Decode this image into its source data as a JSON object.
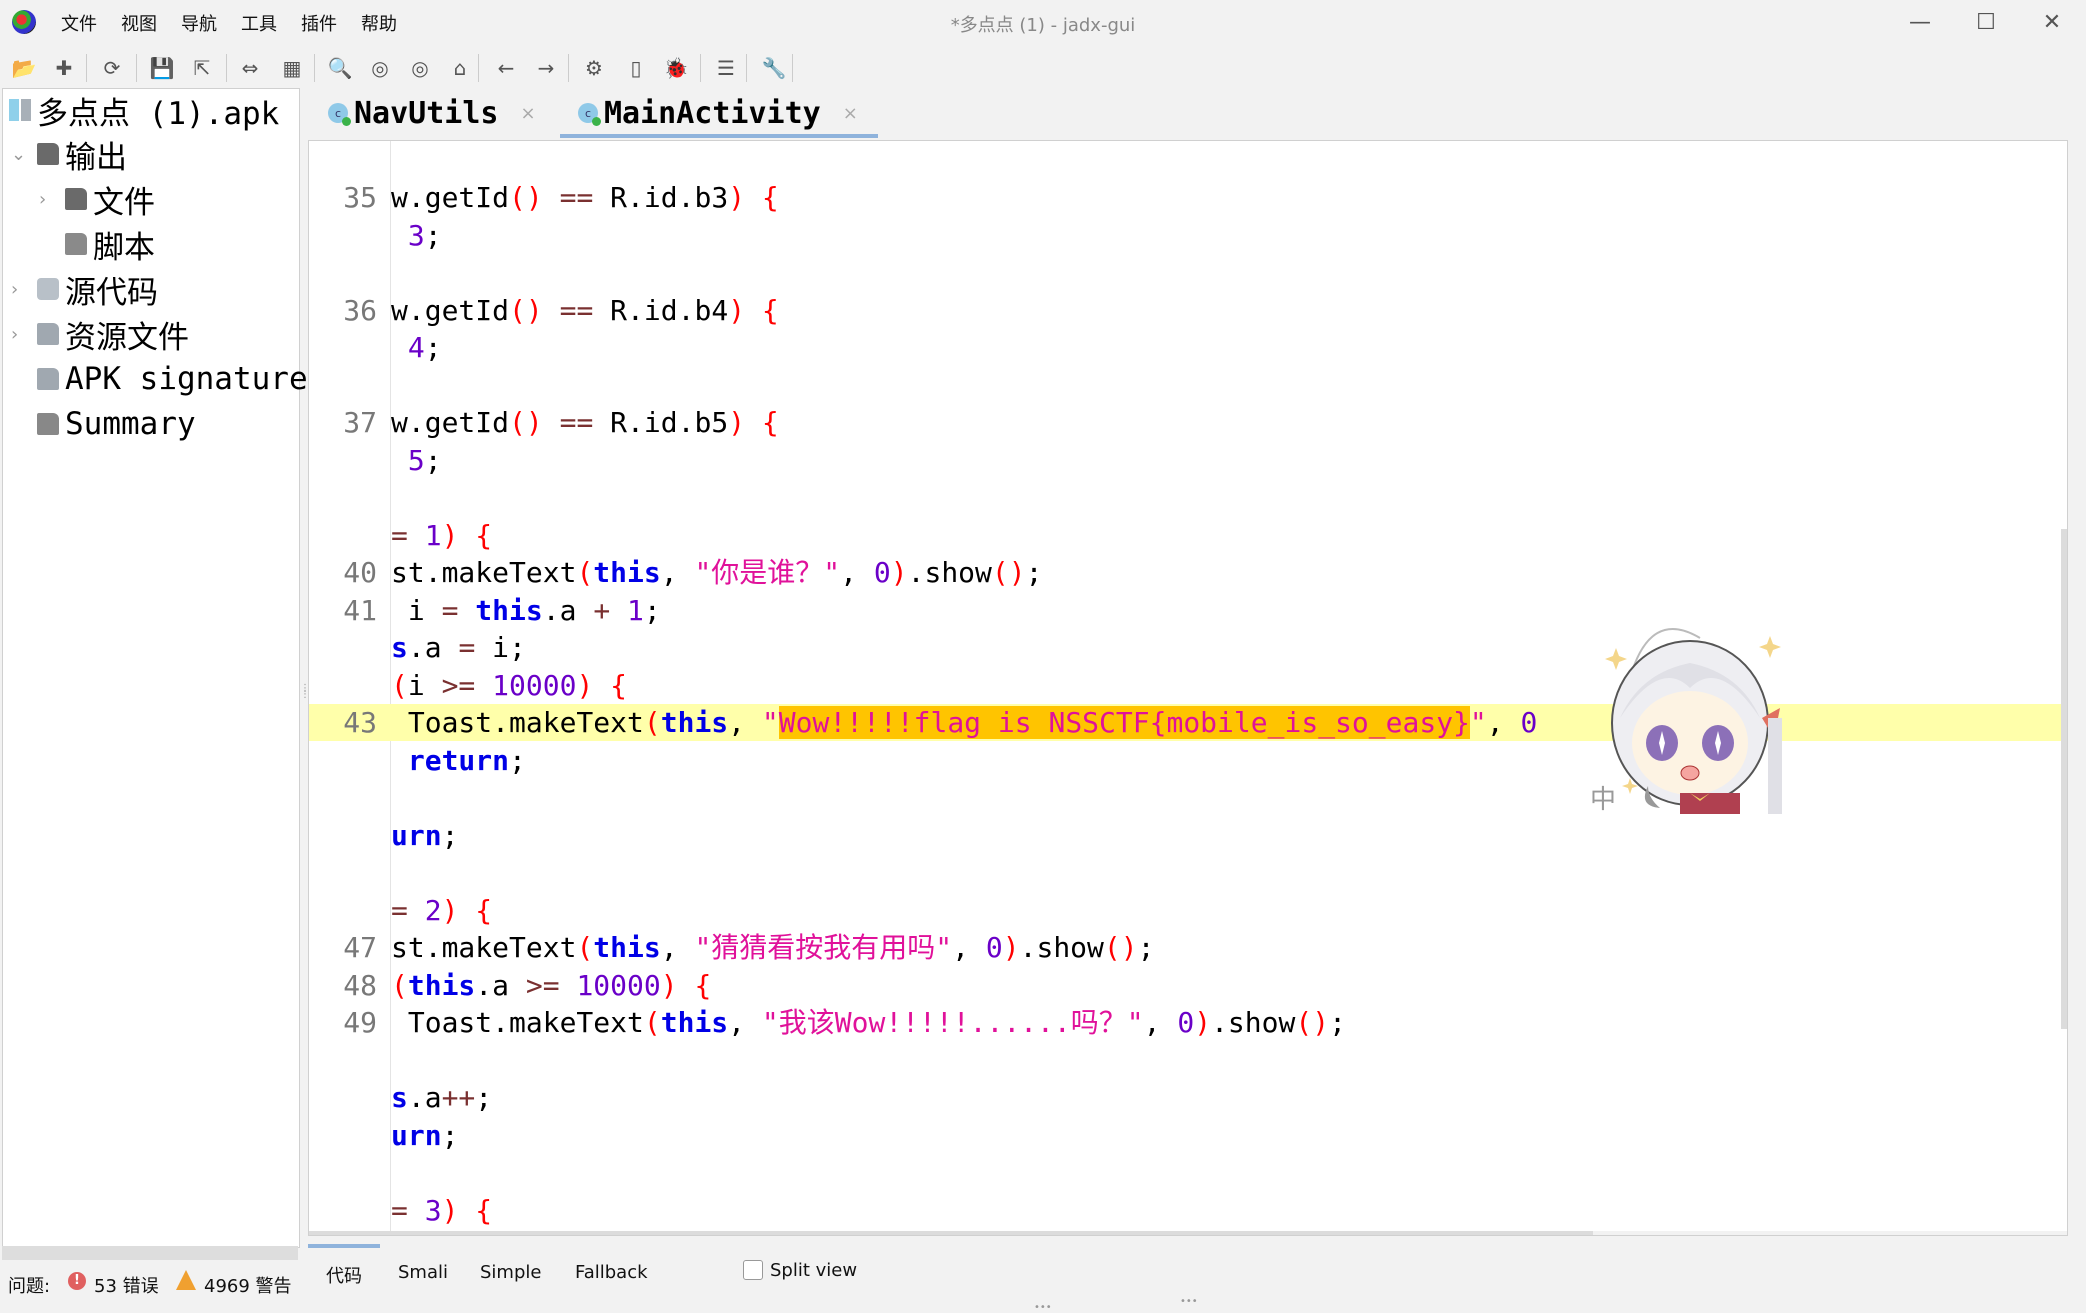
{
  "window": {
    "title": "*多点点 (1) - jadx-gui",
    "controls": {
      "minimize": "—",
      "maximize": "☐",
      "close": "✕"
    }
  },
  "menu": [
    "文件",
    "视图",
    "导航",
    "工具",
    "插件",
    "帮助"
  ],
  "toolbar": [
    {
      "icon": "open-folder-icon",
      "glyph": "📂"
    },
    {
      "icon": "add-file-icon",
      "glyph": "✚"
    },
    {
      "icon": "reload-icon",
      "glyph": "⟳"
    },
    {
      "icon": "save-icon",
      "glyph": "💾"
    },
    {
      "icon": "export-icon",
      "glyph": "⇱"
    },
    {
      "icon": "sync-tree-icon",
      "glyph": "⇔"
    },
    {
      "icon": "flatten-packages-icon",
      "glyph": "▦"
    },
    {
      "icon": "search-icon",
      "glyph": "🔍"
    },
    {
      "icon": "find-class-icon",
      "glyph": "◎"
    },
    {
      "icon": "find-usage-icon",
      "glyph": "◎"
    },
    {
      "icon": "home-icon",
      "glyph": "⌂"
    },
    {
      "icon": "back-icon",
      "glyph": "←"
    },
    {
      "icon": "forward-icon",
      "glyph": "→"
    },
    {
      "icon": "deobfuscation-icon",
      "glyph": "⚙"
    },
    {
      "icon": "device-icon",
      "glyph": "▯"
    },
    {
      "icon": "debugger-icon",
      "glyph": "🐞"
    },
    {
      "icon": "log-viewer-icon",
      "glyph": "☰"
    },
    {
      "icon": "preferences-icon",
      "glyph": "🔧"
    }
  ],
  "tree": {
    "root": "多点点 (1).apk",
    "items": [
      {
        "label": "输出",
        "icon": "output-folder-icon",
        "expanded": true,
        "chevron": "⌄"
      },
      {
        "label": "文件",
        "icon": "files-folder-icon",
        "chevron": "›"
      },
      {
        "label": "脚本",
        "icon": "scripts-folder-icon",
        "chevron": ""
      },
      {
        "label": "源代码",
        "icon": "source-code-icon",
        "chevron": "›"
      },
      {
        "label": "资源文件",
        "icon": "resources-folder-icon",
        "chevron": "›"
      },
      {
        "label": "APK signature",
        "icon": "apk-signature-icon",
        "chevron": ""
      },
      {
        "label": "Summary",
        "icon": "summary-icon",
        "chevron": ""
      }
    ]
  },
  "tabs": [
    {
      "label": "NavUtils",
      "active": false,
      "close": "×",
      "class_glyph": "c"
    },
    {
      "label": "MainActivity",
      "active": true,
      "close": "×",
      "class_glyph": "c"
    }
  ],
  "code": {
    "lines": [
      {
        "ln": "35",
        "segs": [
          [
            "",
            "w.getId"
          ],
          [
            "br",
            "()"
          ],
          [
            "op",
            " == "
          ],
          [
            "",
            "R.id.b3"
          ],
          [
            "br",
            ")"
          ],
          [
            "",
            " "
          ],
          [
            "br",
            "{"
          ]
        ]
      },
      {
        "ln": "",
        "segs": [
          [
            "",
            " "
          ],
          [
            "num",
            "3"
          ],
          [
            "",
            ";"
          ]
        ]
      },
      {
        "ln": "",
        "segs": []
      },
      {
        "ln": "36",
        "segs": [
          [
            "",
            "w.getId"
          ],
          [
            "br",
            "()"
          ],
          [
            "op",
            " == "
          ],
          [
            "",
            "R.id.b4"
          ],
          [
            "br",
            ")"
          ],
          [
            "",
            " "
          ],
          [
            "br",
            "{"
          ]
        ]
      },
      {
        "ln": "",
        "segs": [
          [
            "",
            " "
          ],
          [
            "num",
            "4"
          ],
          [
            "",
            ";"
          ]
        ]
      },
      {
        "ln": "",
        "segs": []
      },
      {
        "ln": "37",
        "segs": [
          [
            "",
            "w.getId"
          ],
          [
            "br",
            "()"
          ],
          [
            "op",
            " == "
          ],
          [
            "",
            "R.id.b5"
          ],
          [
            "br",
            ")"
          ],
          [
            "",
            " "
          ],
          [
            "br",
            "{"
          ]
        ]
      },
      {
        "ln": "",
        "segs": [
          [
            "",
            " "
          ],
          [
            "num",
            "5"
          ],
          [
            "",
            ";"
          ]
        ]
      },
      {
        "ln": "",
        "segs": []
      },
      {
        "ln": "",
        "segs": [
          [
            "op",
            "= "
          ],
          [
            "num",
            "1"
          ],
          [
            "br",
            ")"
          ],
          [
            "",
            " "
          ],
          [
            "br",
            "{"
          ]
        ]
      },
      {
        "ln": "40",
        "segs": [
          [
            "",
            "st.makeText"
          ],
          [
            "br",
            "("
          ],
          [
            "kw",
            "this"
          ],
          [
            "",
            ", "
          ],
          [
            "str",
            "\"你是谁？\""
          ],
          [
            "",
            ", "
          ],
          [
            "num",
            "0"
          ],
          [
            "br",
            ")"
          ],
          [
            "",
            ".show"
          ],
          [
            "br",
            "()"
          ],
          [
            "",
            ";"
          ]
        ]
      },
      {
        "ln": "41",
        "segs": [
          [
            "",
            " i "
          ],
          [
            "op",
            "="
          ],
          [
            "",
            " "
          ],
          [
            "kw",
            "this"
          ],
          [
            "",
            ".a "
          ],
          [
            "op",
            "+"
          ],
          [
            "",
            " "
          ],
          [
            "num",
            "1"
          ],
          [
            "",
            ";"
          ]
        ]
      },
      {
        "ln": "",
        "segs": [
          [
            "kw",
            "s"
          ],
          [
            "",
            ".a "
          ],
          [
            "op",
            "="
          ],
          [
            "",
            " i;"
          ]
        ]
      },
      {
        "ln": "",
        "segs": [
          [
            "br",
            "("
          ],
          [
            "",
            "i "
          ],
          [
            "op",
            ">="
          ],
          [
            "",
            " "
          ],
          [
            "num",
            "10000"
          ],
          [
            "br",
            ")"
          ],
          [
            "",
            " "
          ],
          [
            "br",
            "{"
          ]
        ]
      },
      {
        "ln": "43",
        "highlight": true,
        "segs": [
          [
            "",
            " Toast.makeText"
          ],
          [
            "br",
            "("
          ],
          [
            "kw",
            "this"
          ],
          [
            "",
            ", "
          ],
          [
            "str",
            "\""
          ],
          [
            "str sel",
            "Wow!!!!!flag is NSSCTF{mobile_is_so_easy}"
          ],
          [
            "str",
            "\""
          ],
          [
            "",
            ", "
          ],
          [
            "num",
            "0"
          ]
        ]
      },
      {
        "ln": "",
        "segs": [
          [
            "",
            " "
          ],
          [
            "kw",
            "return"
          ],
          [
            "",
            ";"
          ]
        ]
      },
      {
        "ln": "",
        "segs": []
      },
      {
        "ln": "",
        "segs": [
          [
            "kw",
            "urn"
          ],
          [
            "",
            ";"
          ]
        ]
      },
      {
        "ln": "",
        "segs": []
      },
      {
        "ln": "",
        "segs": [
          [
            "op",
            "= "
          ],
          [
            "num",
            "2"
          ],
          [
            "br",
            ")"
          ],
          [
            "",
            " "
          ],
          [
            "br",
            "{"
          ]
        ]
      },
      {
        "ln": "47",
        "segs": [
          [
            "",
            "st.makeText"
          ],
          [
            "br",
            "("
          ],
          [
            "kw",
            "this"
          ],
          [
            "",
            ", "
          ],
          [
            "str",
            "\"猜猜看按我有用吗\""
          ],
          [
            "",
            ", "
          ],
          [
            "num",
            "0"
          ],
          [
            "br",
            ")"
          ],
          [
            "",
            ".show"
          ],
          [
            "br",
            "()"
          ],
          [
            "",
            ";"
          ]
        ]
      },
      {
        "ln": "48",
        "segs": [
          [
            "br",
            "("
          ],
          [
            "kw",
            "this"
          ],
          [
            "",
            ".a "
          ],
          [
            "op",
            ">="
          ],
          [
            "",
            " "
          ],
          [
            "num",
            "10000"
          ],
          [
            "br",
            ")"
          ],
          [
            "",
            " "
          ],
          [
            "br",
            "{"
          ]
        ]
      },
      {
        "ln": "49",
        "segs": [
          [
            "",
            " Toast.makeText"
          ],
          [
            "br",
            "("
          ],
          [
            "kw",
            "this"
          ],
          [
            "",
            ", "
          ],
          [
            "str",
            "\"我该Wow!!!!!......吗？\""
          ],
          [
            "",
            ", "
          ],
          [
            "num",
            "0"
          ],
          [
            "br",
            ")"
          ],
          [
            "",
            ".show"
          ],
          [
            "br",
            "()"
          ],
          [
            "",
            ";"
          ]
        ]
      },
      {
        "ln": "",
        "segs": []
      },
      {
        "ln": "",
        "segs": [
          [
            "kw",
            "s"
          ],
          [
            "",
            ".a"
          ],
          [
            "op",
            "++"
          ],
          [
            "",
            ";"
          ]
        ]
      },
      {
        "ln": "",
        "segs": [
          [
            "kw",
            "urn"
          ],
          [
            "",
            ";"
          ]
        ]
      },
      {
        "ln": "",
        "segs": []
      },
      {
        "ln": "",
        "segs": [
          [
            "op",
            "= "
          ],
          [
            "num",
            "3"
          ],
          [
            "br",
            ")"
          ],
          [
            "",
            " "
          ],
          [
            "br",
            "{"
          ]
        ]
      }
    ],
    "highlighted_line": "43",
    "selected_text": "Wow!!!!!flag is NSSCTF{mobile_is_so_easy}"
  },
  "overlay": {
    "ime_indicator": "中"
  },
  "bottom_tabs": [
    "代码",
    "Smali",
    "Simple",
    "Fallback"
  ],
  "split_view": {
    "label": "Split view",
    "checked": false
  },
  "status": {
    "label": "问题:",
    "errors": "53 错误",
    "warnings": "4969 警告",
    "error_glyph": "!"
  },
  "colors": {
    "keyword": "#0000e6",
    "number": "#6a00c8",
    "string": "#e0119a",
    "bracket": "#ff0000",
    "line_highlight": "#ffffaa",
    "selection": "#ffc400",
    "tab_underline": "#8fb3dc"
  }
}
